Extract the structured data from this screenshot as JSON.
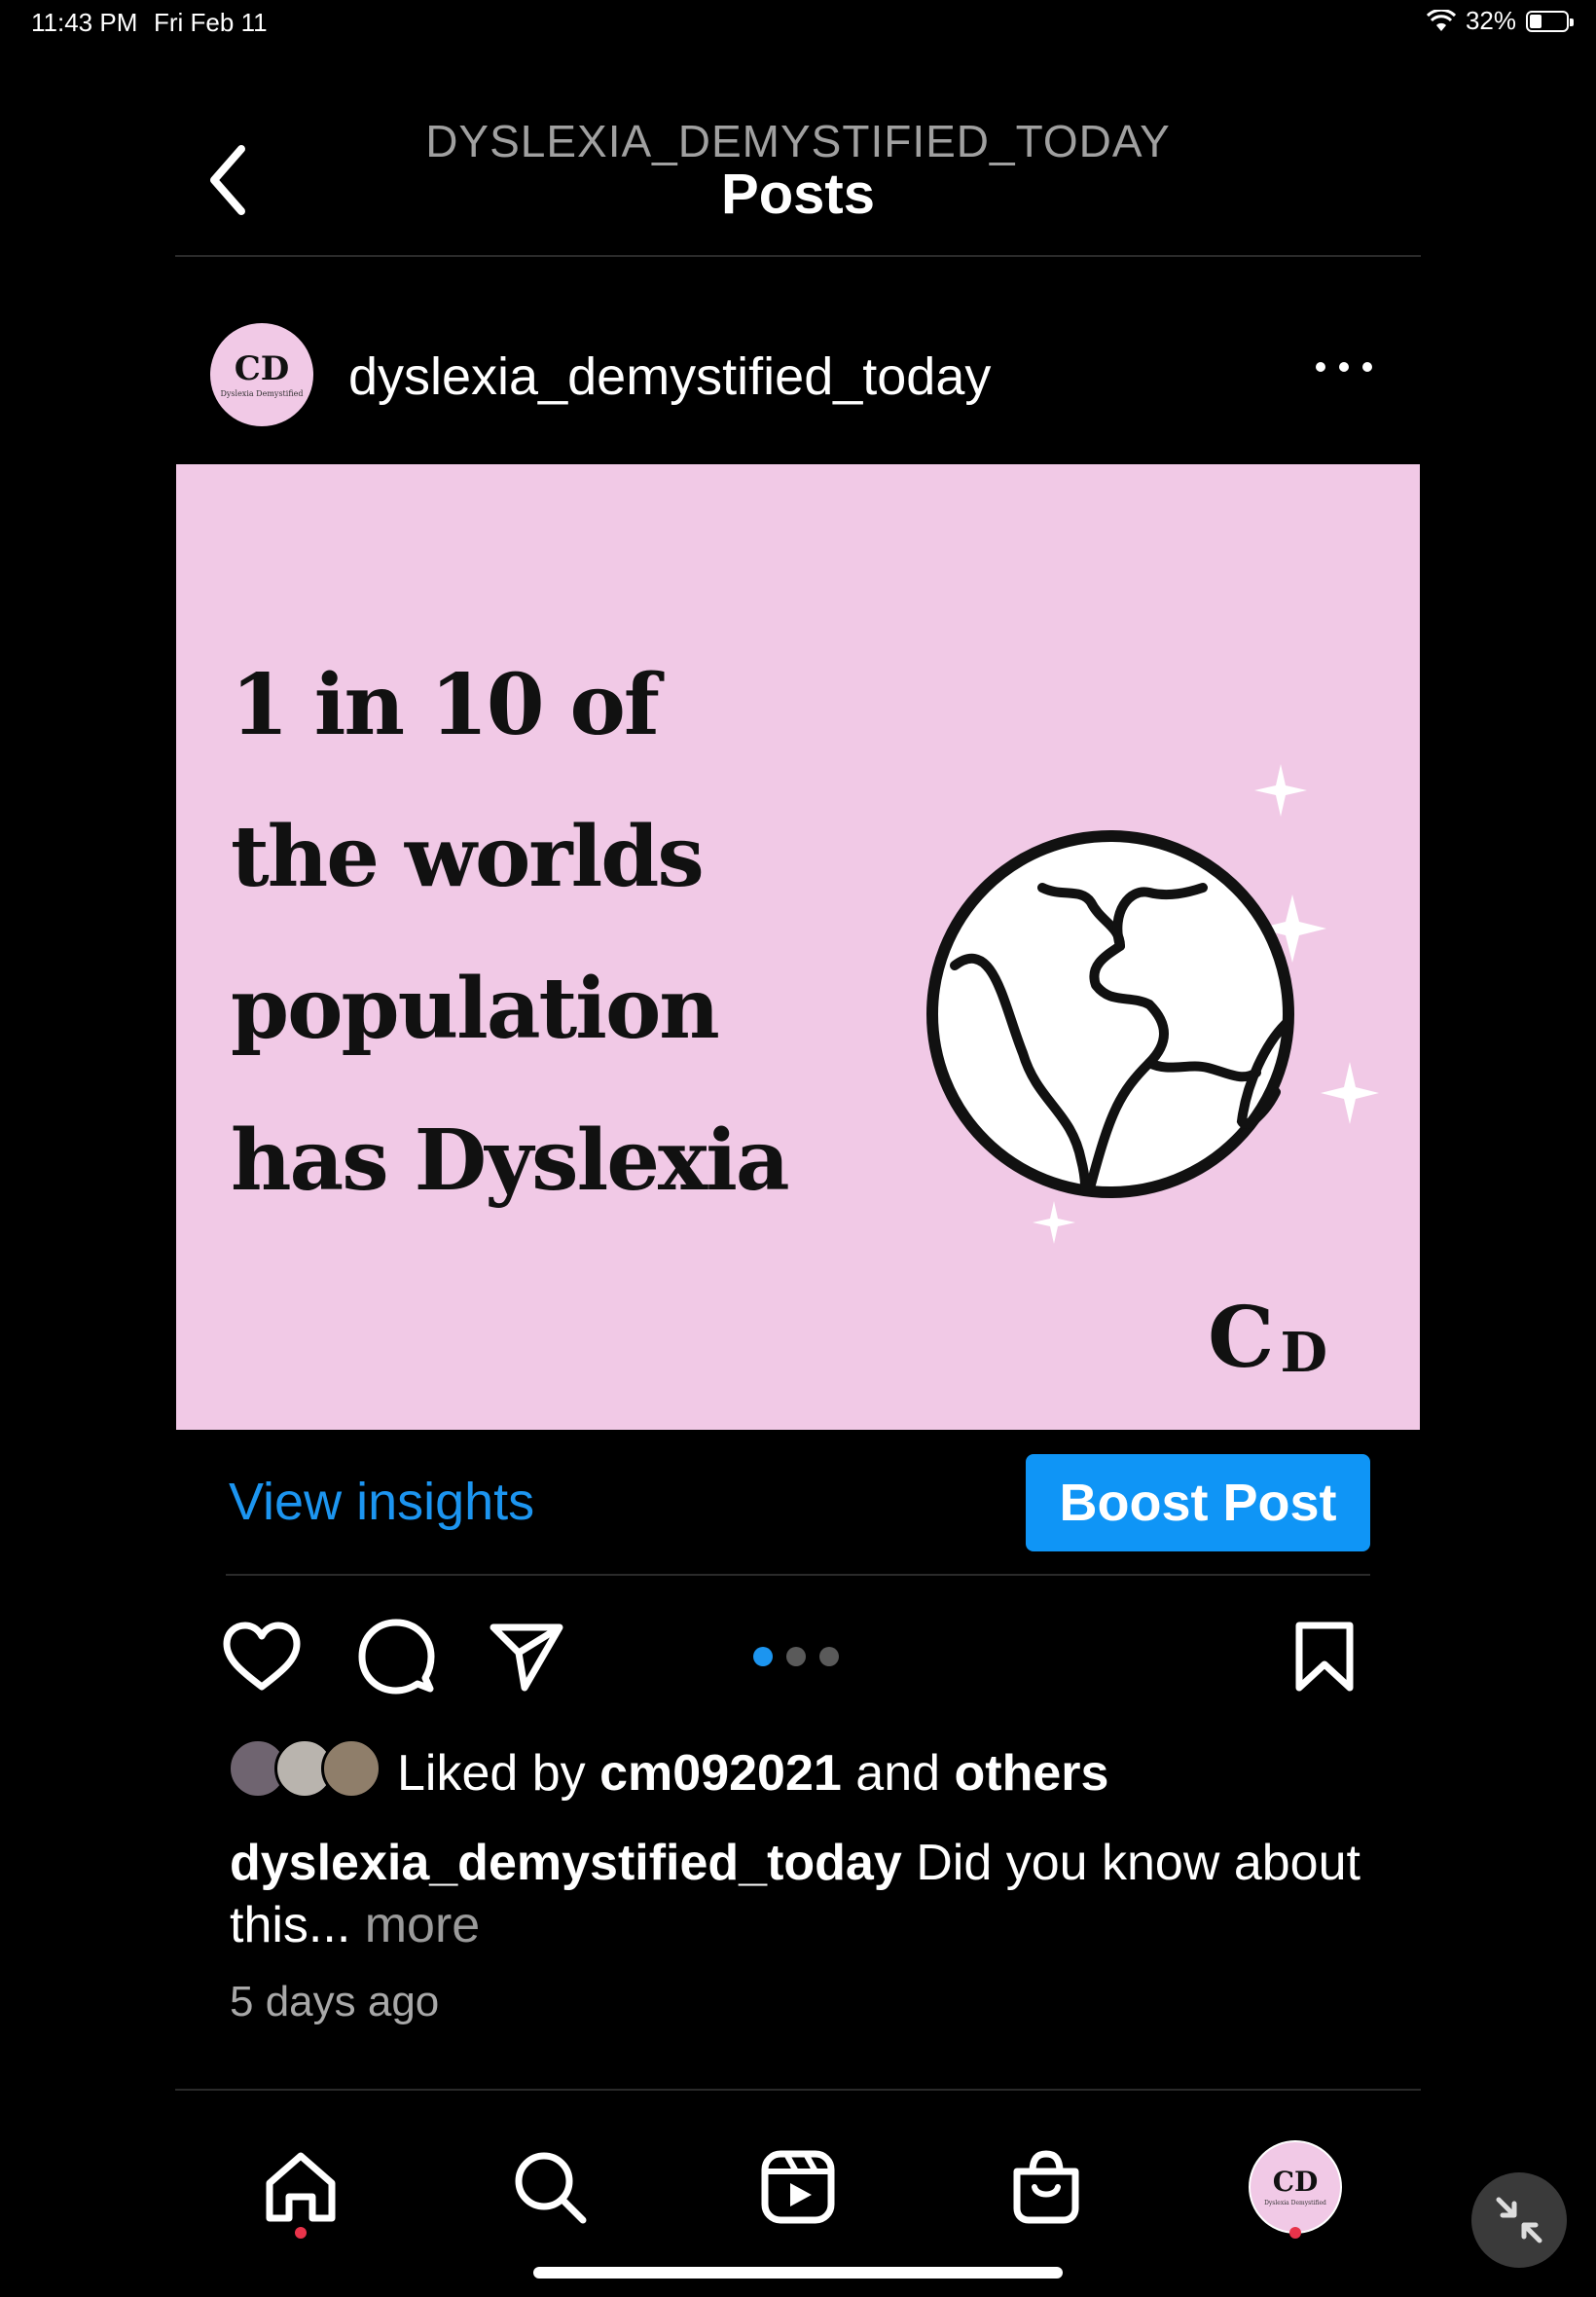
{
  "status_bar": {
    "time": "11:43 PM",
    "date": "Fri Feb 11",
    "battery": "32%",
    "battery_level": 0.32,
    "wifi_icon": "wifi-icon"
  },
  "header": {
    "account": "DYSLEXIA_DEMYSTIFIED_TODAY",
    "title": "Posts",
    "back_icon": "chevron-left-icon"
  },
  "post": {
    "username": "dyslexia_demystified_today",
    "avatar_mark": "ⅭD",
    "avatar_subtitle": "Dyslexia Demystified",
    "more_icon": "more-horizontal-icon",
    "image": {
      "headline_lines": [
        "1 in 10 of",
        "the worlds",
        "population",
        "has Dyslexia"
      ],
      "brand_mark_a": "Ⅽ",
      "brand_mark_b": "D",
      "background_color": "#f1c9e6",
      "illustration": "globe-icon"
    },
    "view_insights_label": "View insights",
    "boost_label": "Boost Post",
    "carousel": {
      "count": 3,
      "active_index": 0
    },
    "likes": {
      "prefix": "Liked by",
      "user": "cm092021",
      "and": "and",
      "others": "others"
    },
    "caption": {
      "user": "dyslexia_demystified_today",
      "text": "Did you know about this...",
      "more": "more"
    },
    "timestamp": "5 days ago"
  },
  "colors": {
    "accent": "#1c95f0",
    "boost_button": "#0f95f6",
    "notification_dot": "#e8334a"
  },
  "bottom_nav": {
    "items": [
      {
        "icon": "home-icon",
        "has_dot": true
      },
      {
        "icon": "search-icon",
        "has_dot": false
      },
      {
        "icon": "reels-icon",
        "has_dot": false
      },
      {
        "icon": "shop-icon",
        "has_dot": false
      },
      {
        "icon": "profile-avatar",
        "has_dot": true
      }
    ]
  },
  "floating_button_icon": "minimize-arrows-icon"
}
